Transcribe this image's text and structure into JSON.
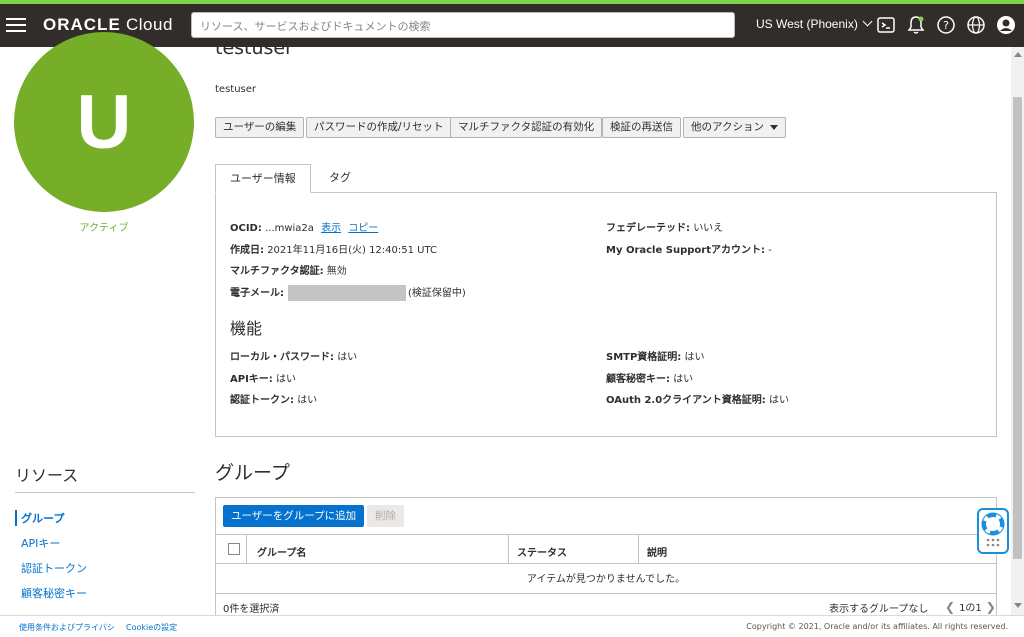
{
  "header": {
    "brand_bold": "ORACLE",
    "brand_light": " Cloud",
    "search_placeholder": "リソース、サービスおよびドキュメントの検索",
    "region": "US West (Phoenix)"
  },
  "profile": {
    "avatar_letter": "U",
    "status": "アクティブ",
    "title": "testuser",
    "subtitle": "testuser"
  },
  "actions": [
    "ユーザーの編集",
    "パスワードの作成/リセット",
    "マルチファクタ認証の有効化",
    "検証の再送信",
    "他のアクション"
  ],
  "tabs": [
    "ユーザー情報",
    "タグ"
  ],
  "info": {
    "ocid_label": "OCID:",
    "ocid_value": "...mwia2a",
    "show_link": "表示",
    "copy_link": "コピー",
    "created_label": "作成日:",
    "created_value": "2021年11月16日(火) 12:40:51 UTC",
    "mfa_label": "マルチファクタ認証:",
    "mfa_value": "無効",
    "email_label": "電子メール:",
    "email_suffix": "(検証保留中)",
    "federated_label": "フェデレーテッド:",
    "federated_value": "いいえ",
    "mos_label": "My Oracle Supportアカウント:",
    "mos_value": "-"
  },
  "capabilities": {
    "heading": "機能",
    "local_password_label": "ローカル・パスワード:",
    "local_password_value": "はい",
    "api_key_label": "APIキー:",
    "api_key_value": "はい",
    "auth_token_label": "認証トークン:",
    "auth_token_value": "はい",
    "smtp_label": "SMTP資格証明:",
    "smtp_value": "はい",
    "customer_secret_label": "顧客秘密キー:",
    "customer_secret_value": "はい",
    "oauth_label": "OAuth 2.0クライアント資格証明:",
    "oauth_value": "はい"
  },
  "resources": {
    "title": "リソース",
    "items": [
      "グループ",
      "APIキー",
      "認証トークン",
      "顧客秘密キー"
    ]
  },
  "groups": {
    "heading": "グループ",
    "add_button": "ユーザーをグループに追加",
    "delete_button": "削除",
    "columns": [
      "グループ名",
      "ステータス",
      "説明"
    ],
    "empty_message": "アイテムが見つかりませんでした。",
    "selected_count": "0件を選択済",
    "pager_text": "表示するグループなし",
    "pager_pages": "1の1"
  },
  "footer": {
    "terms": "使用条件およびプライバシ",
    "cookies": "Cookieの設定",
    "copyright": "Copyright © 2021, Oracle and/or its affiliates. All rights reserved."
  },
  "colors": {
    "header_bg": "#312d2a",
    "accent_green": "#76ae28",
    "link_blue": "#0572ce"
  }
}
